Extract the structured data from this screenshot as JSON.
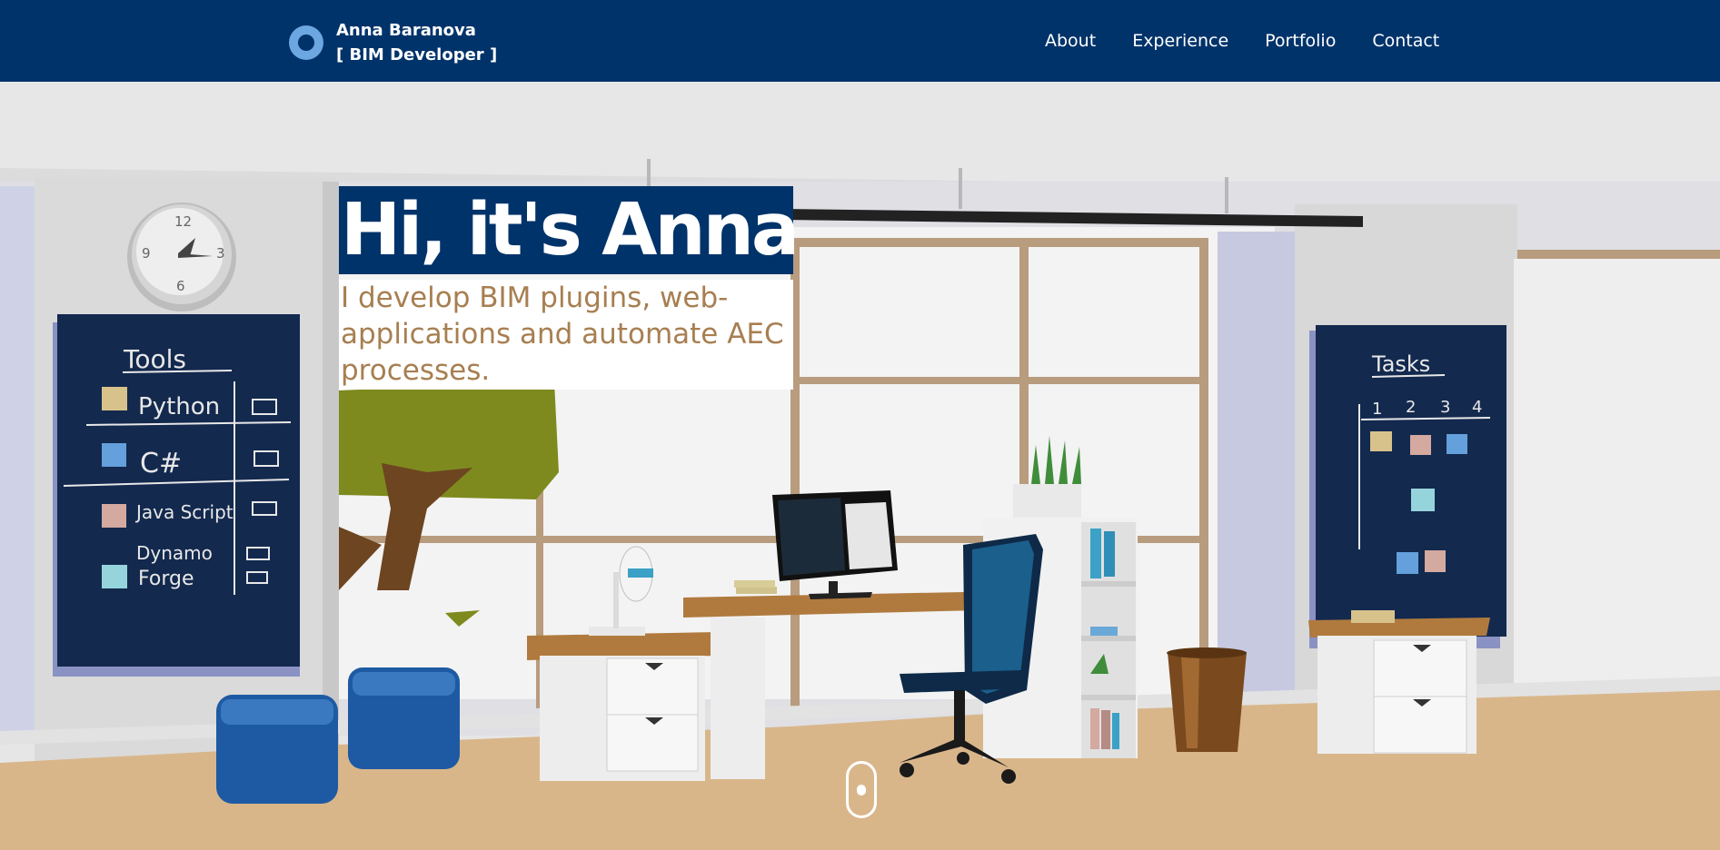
{
  "header": {
    "name": "Anna Baranova",
    "role": "[ BIM Developer ]",
    "logo_icon": "ring-logo-icon",
    "nav": [
      {
        "label": "About"
      },
      {
        "label": "Experience"
      },
      {
        "label": "Portfolio"
      },
      {
        "label": "Contact"
      }
    ]
  },
  "hero": {
    "title": "Hi, it's Anna",
    "subtitle": "I develop BIM plugins, web-applications and automate AEC processes."
  },
  "tools_board": {
    "title": "Tools",
    "items": [
      "Python",
      "C#",
      "Java Script",
      "Dynamo",
      "Forge"
    ]
  },
  "tasks_board": {
    "title": "Tasks",
    "columns": [
      "1",
      "2",
      "3",
      "4"
    ]
  },
  "clock": {
    "numbers": [
      "12",
      "3",
      "6",
      "9"
    ]
  },
  "colors": {
    "header_bg": "#00336a",
    "accent_text": "#a77f51",
    "board": "#13294e",
    "floor": "#d9b68a",
    "chair": "#1b5f8c"
  },
  "icons": {
    "scroll": "mouse-scroll-icon"
  }
}
